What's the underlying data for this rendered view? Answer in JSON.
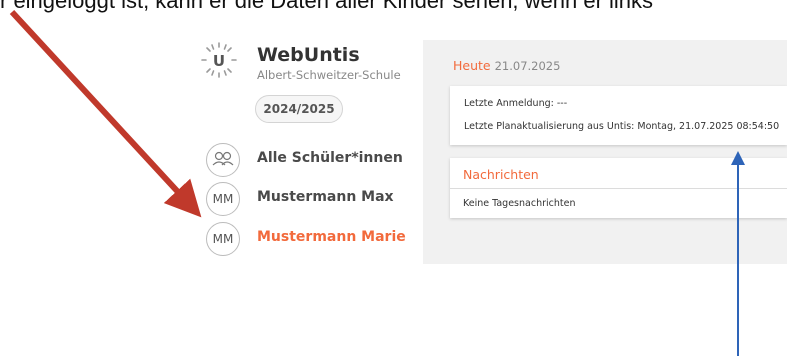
{
  "caption_fragment": "r eingeloggt ist, kann er die Daten aller Kinder sehen, wenn er links",
  "app": {
    "name": "WebUntis",
    "school": "Albert-Schweitzer-Schule",
    "school_year": "2024/2025"
  },
  "sidebar": {
    "items": [
      {
        "avatar": "",
        "icon": "group-icon",
        "label": "Alle Schüler*innen"
      },
      {
        "avatar": "MM",
        "label": "Mustermann Max"
      },
      {
        "avatar": "MM",
        "label": "Mustermann Marie",
        "active": true
      }
    ]
  },
  "main": {
    "today_label": "Heute",
    "today_date": "21.07.2025",
    "login_info": "Letzte Anmeldung: ---",
    "timetable_update": "Letzte Planaktualisierung aus Untis: Montag, 21.07.2025 08:54:50",
    "messages_title": "Nachrichten",
    "messages_empty": "Keine Tagesnachrichten"
  },
  "colors": {
    "accent": "#f26a3c",
    "red_arrow": "#c0392b",
    "blue_arrow": "#2e64b8",
    "panel_bg": "#f1f1f1"
  }
}
